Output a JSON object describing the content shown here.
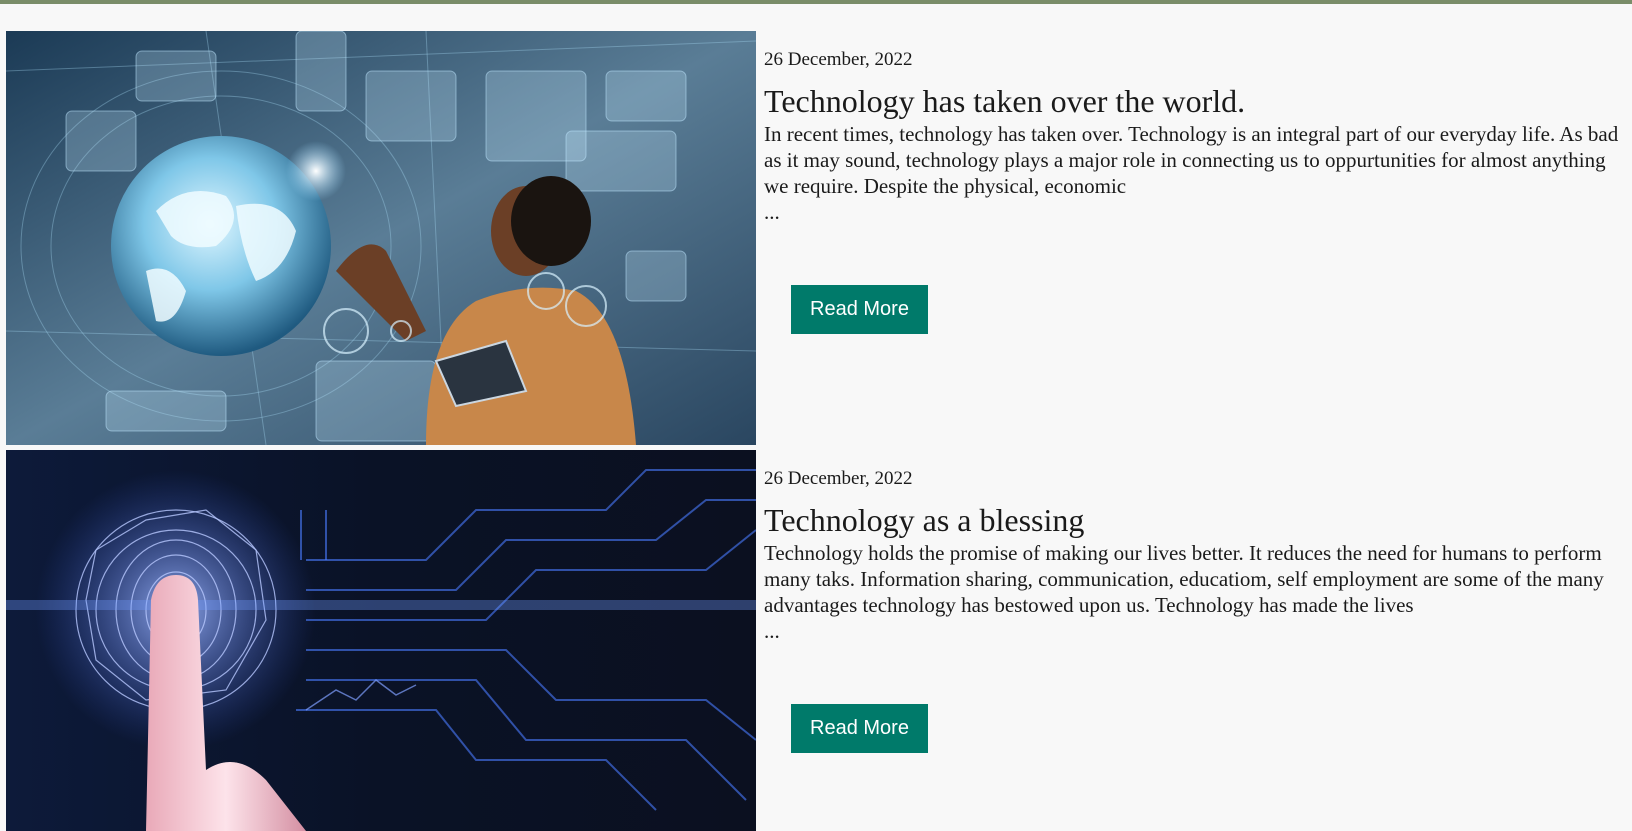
{
  "colors": {
    "topbar": "#7a8d69",
    "button": "#007a6a",
    "background": "#f8f8f8"
  },
  "posts": [
    {
      "image_icon": "photo-woman-holographic-globe",
      "date": "26 December, 2022",
      "title": "Technology has taken over the world.",
      "excerpt": "In recent times, technology has taken over. Technology is an integral part of our everyday life. As bad as it may sound, technology plays a major role in connecting us to oppurtunities for almost anything we require. Despite the physical, economic",
      "ellipsis": "...",
      "button_label": "Read More"
    },
    {
      "image_icon": "photo-fingerprint-circuit",
      "date": "26 December, 2022",
      "title": "Technology as a blessing",
      "excerpt": "Technology holds the promise of making our lives better. It reduces the need for humans to perform many taks. Information sharing, communication, educatiom, self employment are some of the many advantages technology has bestowed upon us. Technology has made the lives",
      "ellipsis": "...",
      "button_label": "Read More"
    }
  ]
}
